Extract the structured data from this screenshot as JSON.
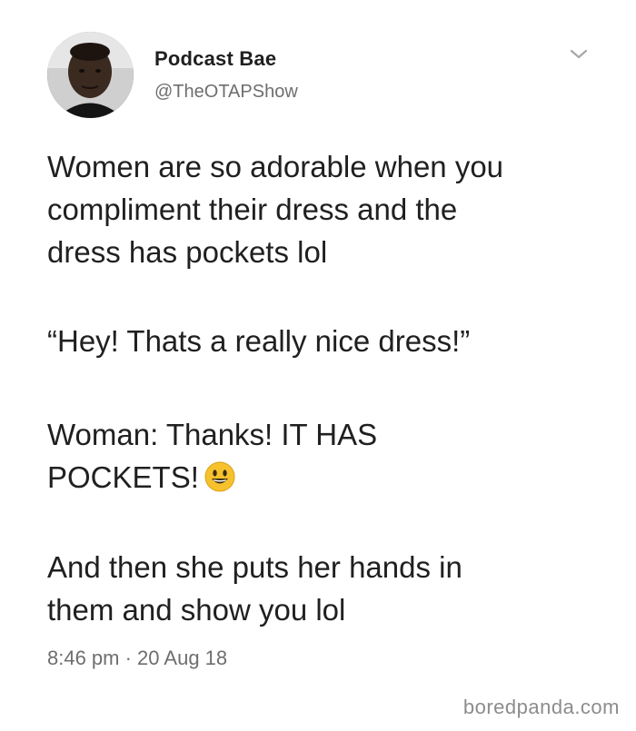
{
  "tweet": {
    "display_name": "Podcast Bae",
    "handle": "@TheOTAPShow",
    "paragraphs": [
      "Women are so adorable when you\ncompliment their dress and the\ndress has pockets lol",
      "“Hey! Thats a really nice dress!”",
      "Woman: Thanks! IT HAS\nPOCKETS!",
      "And then she puts her hands in\nthem and show you lol"
    ],
    "emoji": "smiling-face-emoji",
    "timestamp": "8:46 pm · 20 Aug 18"
  },
  "icons": {
    "caret": "chevron-down-icon",
    "avatar": "avatar"
  },
  "watermark": "boredpanda.com",
  "colors": {
    "text": "#202020",
    "muted": "#6e6e6e",
    "emoji_yellow": "#f6c12d",
    "background": "#ffffff"
  }
}
